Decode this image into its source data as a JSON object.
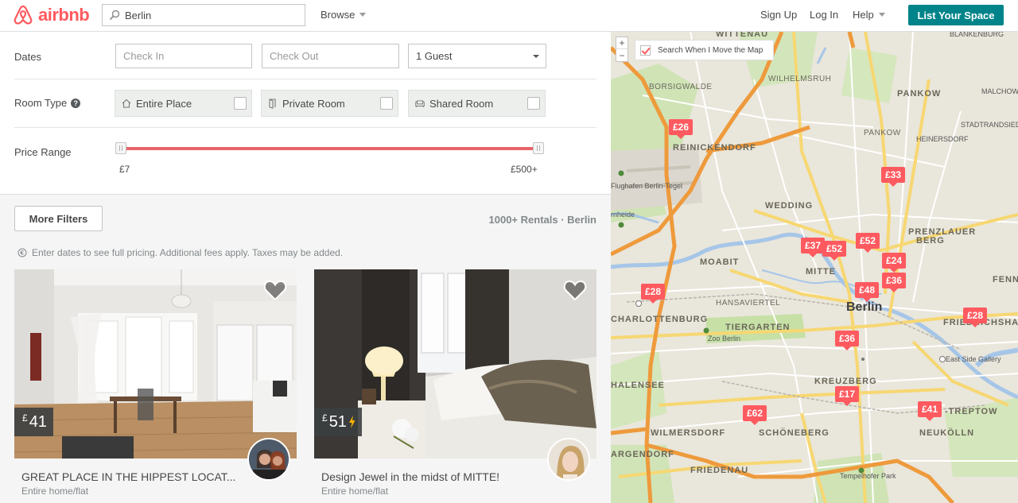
{
  "header": {
    "logo_text": "airbnb",
    "search_value": "Berlin",
    "browse_label": "Browse",
    "sign_up": "Sign Up",
    "log_in": "Log In",
    "help": "Help",
    "list_space": "List Your Space"
  },
  "filters": {
    "dates_label": "Dates",
    "check_in_placeholder": "Check In",
    "check_out_placeholder": "Check Out",
    "guests_value": "1 Guest",
    "room_type_label": "Room Type",
    "room_types": [
      {
        "label": "Entire Place",
        "icon": "home-icon",
        "checked": false
      },
      {
        "label": "Private Room",
        "icon": "door-icon",
        "checked": false
      },
      {
        "label": "Shared Room",
        "icon": "sofa-icon",
        "checked": false
      }
    ],
    "price_range_label": "Price Range",
    "price_min": "£7",
    "price_max": "£500+"
  },
  "results": {
    "more_filters": "More Filters",
    "rentals_count": "1000+ Rentals · Berlin",
    "price_note": "Enter dates to see full pricing. Additional fees apply. Taxes may be added.",
    "listings": [
      {
        "currency": "£",
        "price": "41",
        "instant_book": false,
        "title": "GREAT PLACE IN THE HIPPEST LOCAT...",
        "room_type": "Entire home/flat"
      },
      {
        "currency": "£",
        "price": "51",
        "instant_book": true,
        "title": "Design Jewel in the midst of MITTE!",
        "room_type": "Entire home/flat"
      }
    ]
  },
  "map": {
    "search_when_move": "Search When I Move the Map",
    "search_when_move_checked": true,
    "zoom_in": "+",
    "zoom_out": "−",
    "pins": [
      "£26",
      "£33",
      "£37",
      "£52",
      "£52",
      "£24",
      "£36",
      "£48",
      "£28",
      "£28",
      "£36",
      "£17",
      "£62",
      "£41"
    ],
    "labels": {
      "wittenau": "WITTENAU",
      "blankenburg": "BLANKENBURG",
      "borsigwalde": "BORSIGWALDE",
      "wilhelmsruh": "WILHELMSRUH",
      "pankow_caps": "PANKOW",
      "pankow": "PANKOW",
      "reinickendorf": "REINICKENDORF",
      "tegel": "Flughafen Berlin-Tegel",
      "wedding": "WEDDING",
      "prenzlauer": "PRENZLAUER",
      "berg": "BERG",
      "moabit": "MOABIT",
      "mitte": "MITTE",
      "berlin": "Berlin",
      "hansaviertel": "HANSAVIERTEL",
      "charlottenburg": "CHARLOTTENBURG",
      "tiergarten": "TIERGARTEN",
      "friedrichshain": "FRIEDRICHSHAIN",
      "zoo": "Zoo Berlin",
      "eastside": "East Side Gallery",
      "halensee": "HALENSEE",
      "kreuzberg": "KREUZBERG",
      "treptow": "-TREPTOW",
      "wilmersdorf": "WILMERSDORF",
      "schoneberg": "SCHÖNEBERG",
      "neukolln": "NEUKÖLLN",
      "friedenau": "FRIEDENAU",
      "tempelhofer": "Tempelhofer Park",
      "gargendorf": "ARGENDORF",
      "stadtrand": "STADTRANDSIEDLUNG",
      "malchow": "MALCHOW",
      "heinersdorf": "HEINERSDORF",
      "fennp": "FENNP",
      "heide": "rnheide"
    }
  }
}
